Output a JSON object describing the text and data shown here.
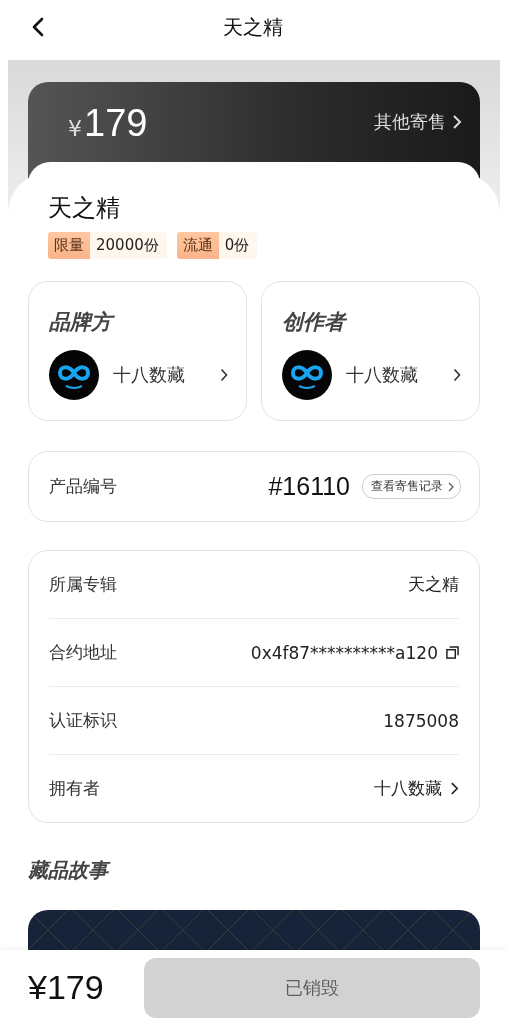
{
  "header": {
    "title": "天之精"
  },
  "price_card": {
    "currency": "¥",
    "price": "179",
    "other_link": "其他寄售"
  },
  "item": {
    "name": "天之精",
    "tags": [
      {
        "label": "限量",
        "value": "20000份"
      },
      {
        "label": "流通",
        "value": "0份"
      }
    ]
  },
  "parties": [
    {
      "heading": "品牌方",
      "name": "十八数藏"
    },
    {
      "heading": "创作者",
      "name": "十八数藏"
    }
  ],
  "product_number": {
    "label": "产品编号",
    "value": "#16110",
    "link": "查看寄售记录"
  },
  "details": [
    {
      "label": "所属专辑",
      "value": "天之精",
      "kind": "plain"
    },
    {
      "label": "合约地址",
      "value": "0x4f87**********a120",
      "kind": "copy"
    },
    {
      "label": "认证标识",
      "value": "1875008",
      "kind": "plain"
    },
    {
      "label": "拥有者",
      "value": "十八数藏",
      "kind": "link"
    }
  ],
  "story": {
    "heading": "藏品故事",
    "kind": "picture"
  },
  "footer": {
    "price": "¥179",
    "button": {
      "label": "已销毁",
      "disabled": true
    }
  }
}
